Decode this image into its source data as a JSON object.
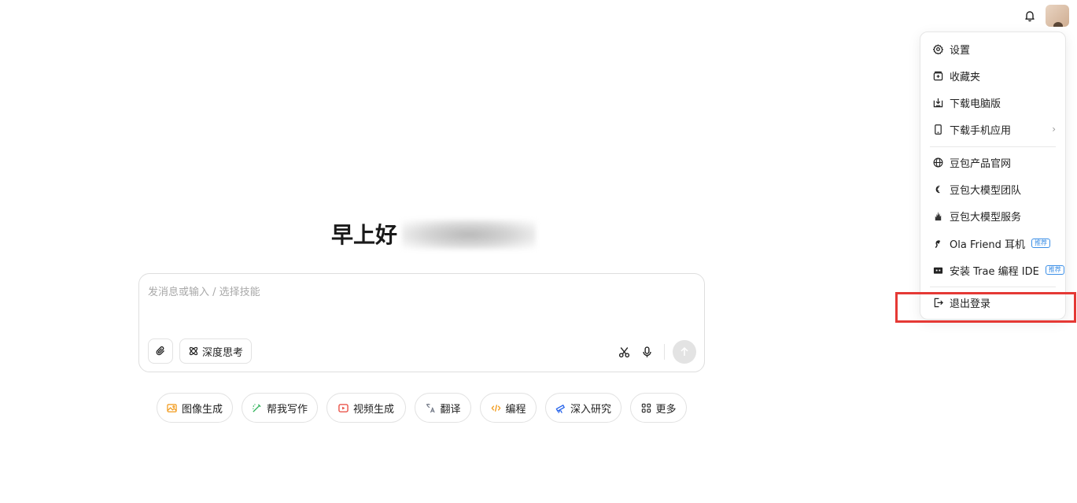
{
  "header": {
    "bell_icon": "bell-icon",
    "avatar_icon": "avatar"
  },
  "menu": {
    "items": [
      {
        "label": "设置",
        "icon": "gear-icon"
      },
      {
        "label": "收藏夹",
        "icon": "bookmark-icon"
      },
      {
        "label": "下载电脑版",
        "icon": "download-desktop-icon"
      },
      {
        "label": "下载手机应用",
        "icon": "phone-icon"
      },
      {
        "label": "豆包产品官网",
        "icon": "globe-icon"
      },
      {
        "label": "豆包大模型团队",
        "icon": "team-icon"
      },
      {
        "label": "豆包大模型服务",
        "icon": "service-icon"
      },
      {
        "label": "Ola Friend 耳机",
        "icon": "earphone-icon",
        "tag": "推荐"
      },
      {
        "label": "安装 Trae 编程 IDE",
        "icon": "trae-icon",
        "tag": "推荐"
      },
      {
        "label": "退出登录",
        "icon": "logout-icon"
      }
    ]
  },
  "greeting": {
    "text": "早上好"
  },
  "composer": {
    "placeholder": "发消息或输入 / 选择技能",
    "deep_think_label": "深度思考"
  },
  "skills": [
    {
      "label": "图像生成",
      "icon": "image-gen-icon",
      "color": "#f29a1a"
    },
    {
      "label": "帮我写作",
      "icon": "pen-icon",
      "color": "#2fb35a"
    },
    {
      "label": "视频生成",
      "icon": "video-icon",
      "color": "#e8473b"
    },
    {
      "label": "翻译",
      "icon": "translate-icon",
      "color": "#6b7280"
    },
    {
      "label": "编程",
      "icon": "code-icon",
      "color": "#f29a1a"
    },
    {
      "label": "深入研究",
      "icon": "telescope-icon",
      "color": "#2563eb"
    },
    {
      "label": "更多",
      "icon": "grid-icon",
      "color": "#333333"
    }
  ]
}
